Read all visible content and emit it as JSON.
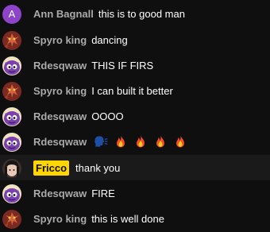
{
  "chat": {
    "messages": [
      {
        "author": "Ann Bagnall",
        "text": "this is to good man",
        "avatar": "letter",
        "avatar_letter": "A"
      },
      {
        "author": "Spyro king",
        "text": "dancing",
        "avatar": "spyro-avatar-icon"
      },
      {
        "author": "Rdesqwaw",
        "text": "THIS IF FIRS",
        "avatar": "purple-creature-avatar-icon"
      },
      {
        "author": "Spyro king",
        "text": "I can built it better",
        "avatar": "spyro-avatar-icon"
      },
      {
        "author": "Rdesqwaw",
        "text": "OOOO",
        "avatar": "purple-creature-avatar-icon"
      },
      {
        "author": "Rdesqwaw",
        "text": "",
        "avatar": "purple-creature-avatar-icon",
        "emojis": [
          "speaking-head-icon",
          "fire-icon",
          "fire-icon",
          "fire-icon",
          "fire-icon"
        ]
      },
      {
        "author": "Fricco",
        "text": "thank you",
        "avatar": "dark-hair-avatar-icon",
        "highlighted": true,
        "badge_color": "#ffd600"
      },
      {
        "author": "Rdesqwaw",
        "text": "FIRE",
        "avatar": "purple-creature-avatar-icon"
      },
      {
        "author": "Spyro king",
        "text": "this is well done",
        "avatar": "spyro-avatar-icon"
      }
    ]
  },
  "colors": {
    "background": "#0f0f0f",
    "author_name": "#aaaaaa",
    "message_text": "#ffffff",
    "highlight_row": "#1a1a1a",
    "owner_badge": "#ffd600",
    "letter_avatar": "#8e44c9"
  }
}
